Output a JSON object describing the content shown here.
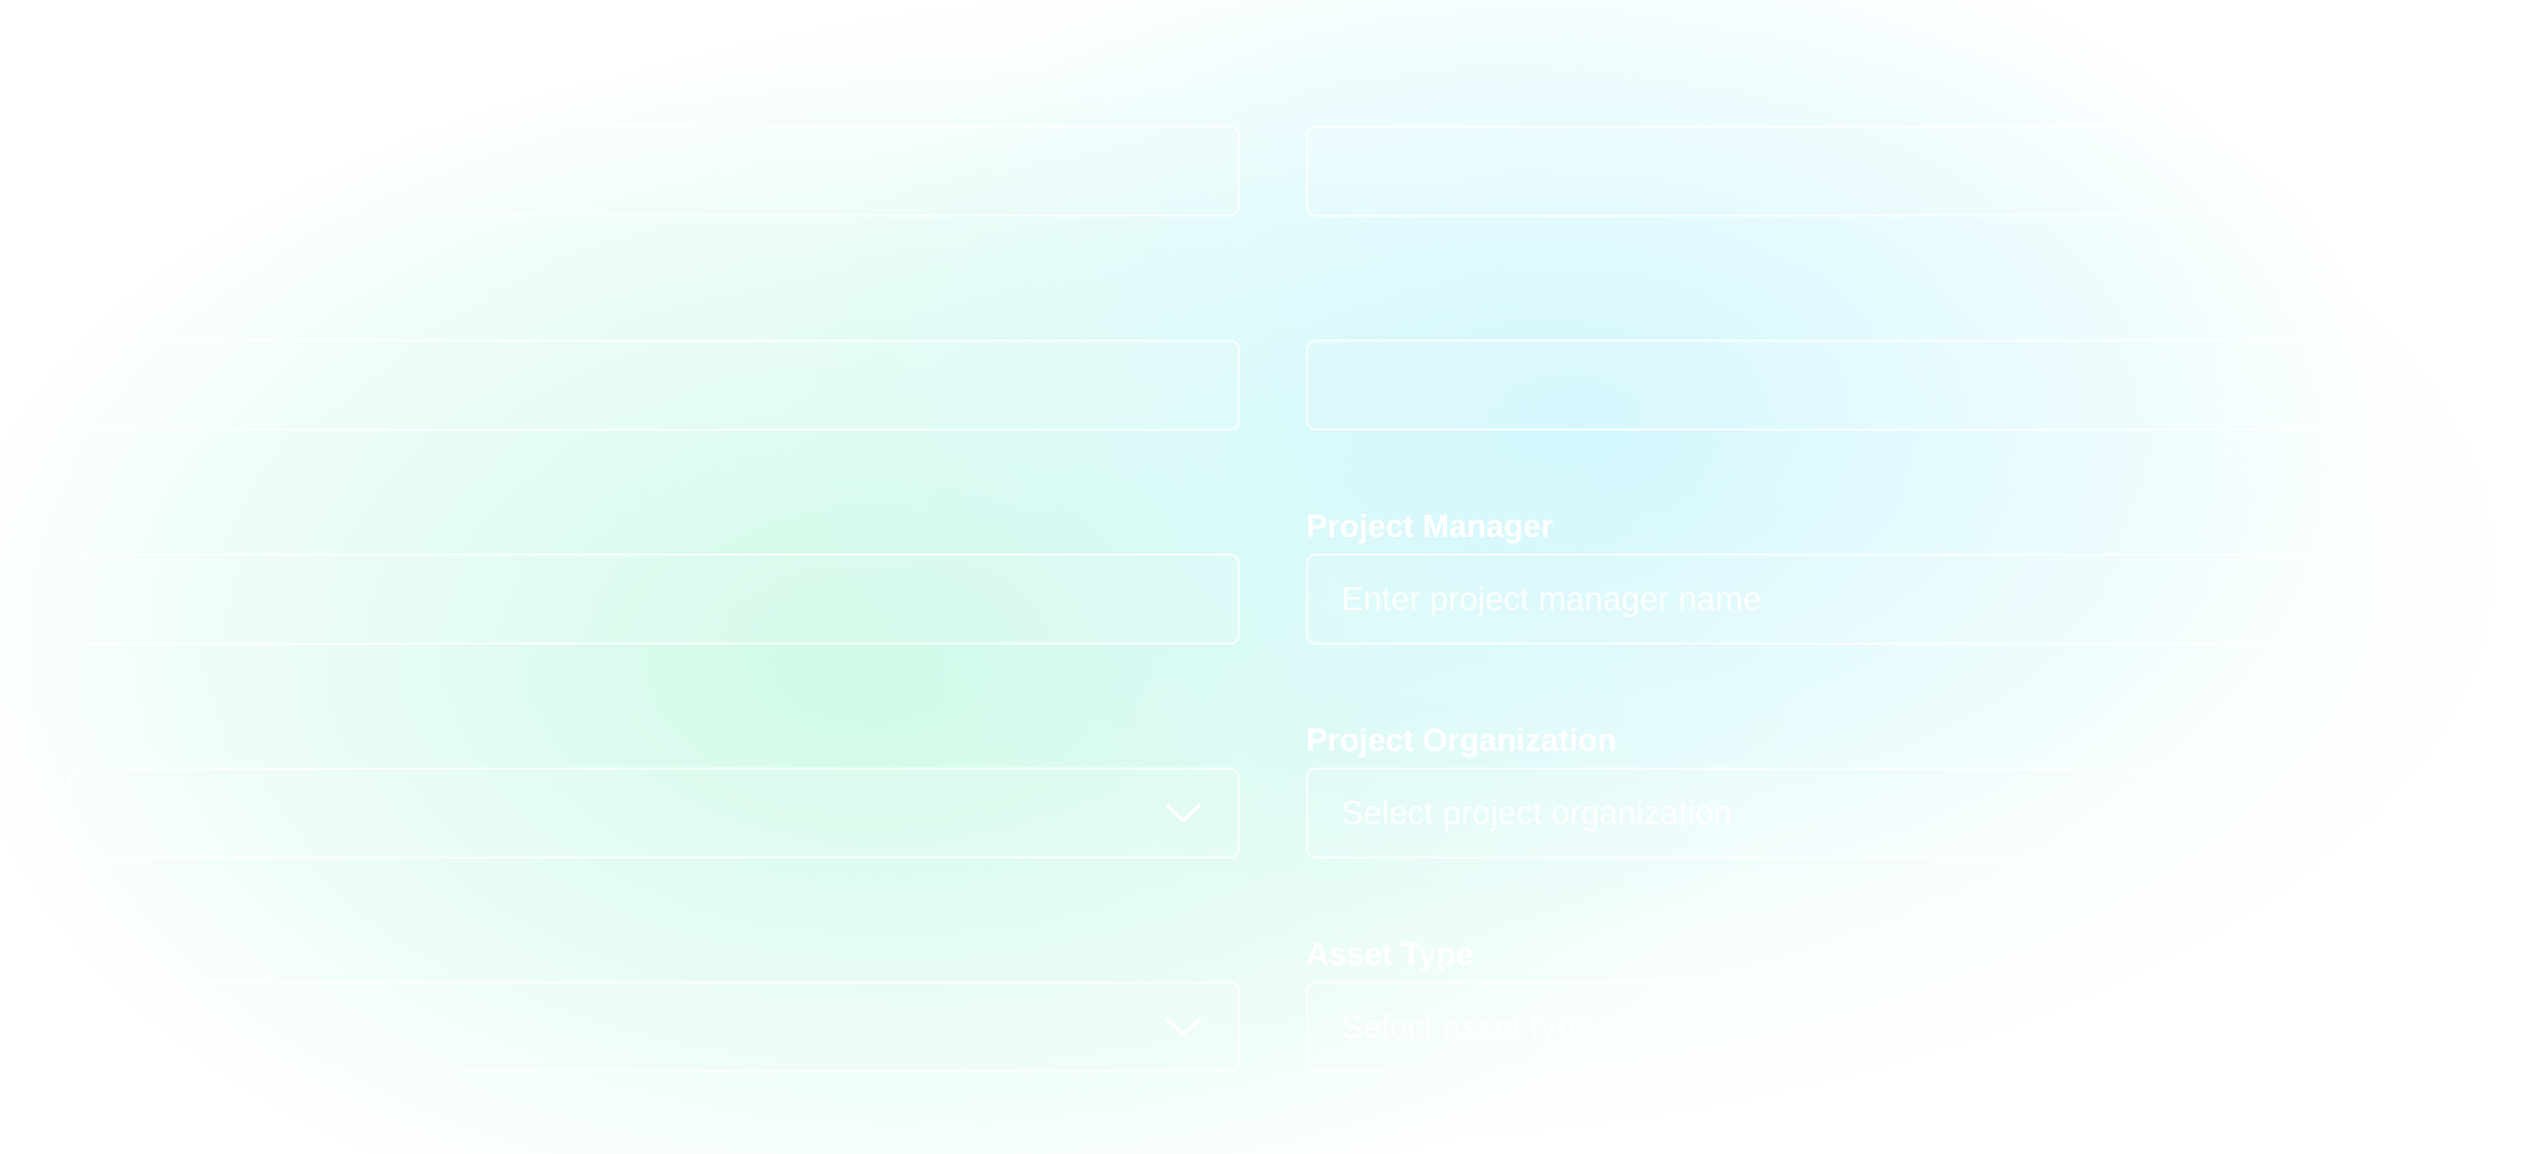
{
  "form": {
    "left": [
      {
        "label": "",
        "placeholder": "",
        "dropdown": false
      },
      {
        "label": "",
        "placeholder": "",
        "dropdown": false
      },
      {
        "label": "",
        "placeholder": "",
        "dropdown": false
      },
      {
        "label": "",
        "placeholder": "",
        "dropdown": true
      },
      {
        "label": "",
        "placeholder": "",
        "dropdown": true
      }
    ],
    "right": [
      {
        "label": "",
        "placeholder": "",
        "dropdown": false
      },
      {
        "label": "",
        "placeholder": "",
        "dropdown": false
      },
      {
        "label": "Project Manager",
        "placeholder": "Enter project manager name",
        "dropdown": false
      },
      {
        "label": "Project Organization",
        "placeholder": "Select project organization",
        "dropdown": false
      },
      {
        "label": "Asset Type",
        "placeholder": "Select asset type",
        "dropdown": false
      }
    ]
  },
  "icons": {
    "dropdown": "chevron-down-icon"
  },
  "colors": {
    "text": "#ffffff",
    "bg_mint": "#e6fbf1",
    "bg_cyan": "#e2f8fd"
  }
}
